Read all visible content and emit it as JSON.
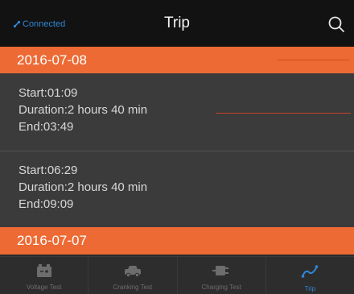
{
  "header": {
    "connection_status": "Connected",
    "title": "Trip",
    "search_icon": "search-icon",
    "link_icon": "link-icon",
    "status_color": "#2f86d6"
  },
  "groups": [
    {
      "date": "2016-07-08",
      "trips": [
        {
          "start": "Start:01:09",
          "duration": "Duration:2 hours 40 min",
          "end": "End:03:49"
        },
        {
          "start": "Start:06:29",
          "duration": "Duration:2 hours 40 min",
          "end": "End:09:09"
        }
      ]
    },
    {
      "date": "2016-07-07",
      "trips": []
    }
  ],
  "tabs": [
    {
      "label": "Voltage Test",
      "icon": "battery-icon",
      "active": false
    },
    {
      "label": "Cranking Test",
      "icon": "car-icon",
      "active": false
    },
    {
      "label": "Charging Test",
      "icon": "plug-icon",
      "active": false
    },
    {
      "label": "Trip",
      "icon": "trip-route-icon",
      "active": true
    }
  ],
  "colors": {
    "accent": "#ed6a35",
    "header_bg": "#121212",
    "row_bg": "#3b3b3b",
    "active_tab": "#2f86d6"
  }
}
